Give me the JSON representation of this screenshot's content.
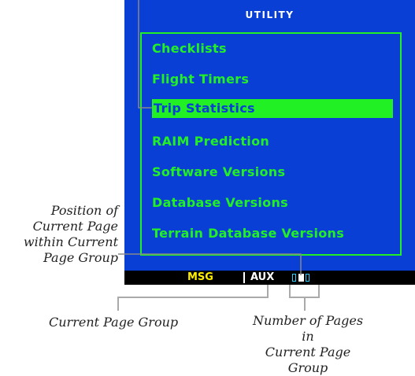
{
  "screen": {
    "title": "UTILITY",
    "colors": {
      "background": "#0a3fd6",
      "text": "#21f025",
      "status_bar": "#000000",
      "msg": "#ffee00"
    }
  },
  "menu": {
    "items": [
      {
        "label": "Checklists",
        "selected": false
      },
      {
        "label": "Flight Timers",
        "selected": false
      },
      {
        "label": "Trip Statistics",
        "selected": true
      },
      {
        "label": "RAIM Prediction",
        "selected": false
      },
      {
        "label": "Software Versions",
        "selected": false
      },
      {
        "label": "Database Versions",
        "selected": false
      },
      {
        "label": "Terrain Database Versions",
        "selected": false
      }
    ]
  },
  "status_bar": {
    "msg_label": "MSG",
    "group_label": "AUX",
    "pages_in_group": 3,
    "current_page": 2
  },
  "callouts": {
    "position_line1": "Position of",
    "position_line2": "Current Page",
    "position_line3": "within Current",
    "position_line4": "Page Group",
    "group": "Current Page Group",
    "pages_line1": "Number of Pages in",
    "pages_line2": "Current Page Group"
  }
}
